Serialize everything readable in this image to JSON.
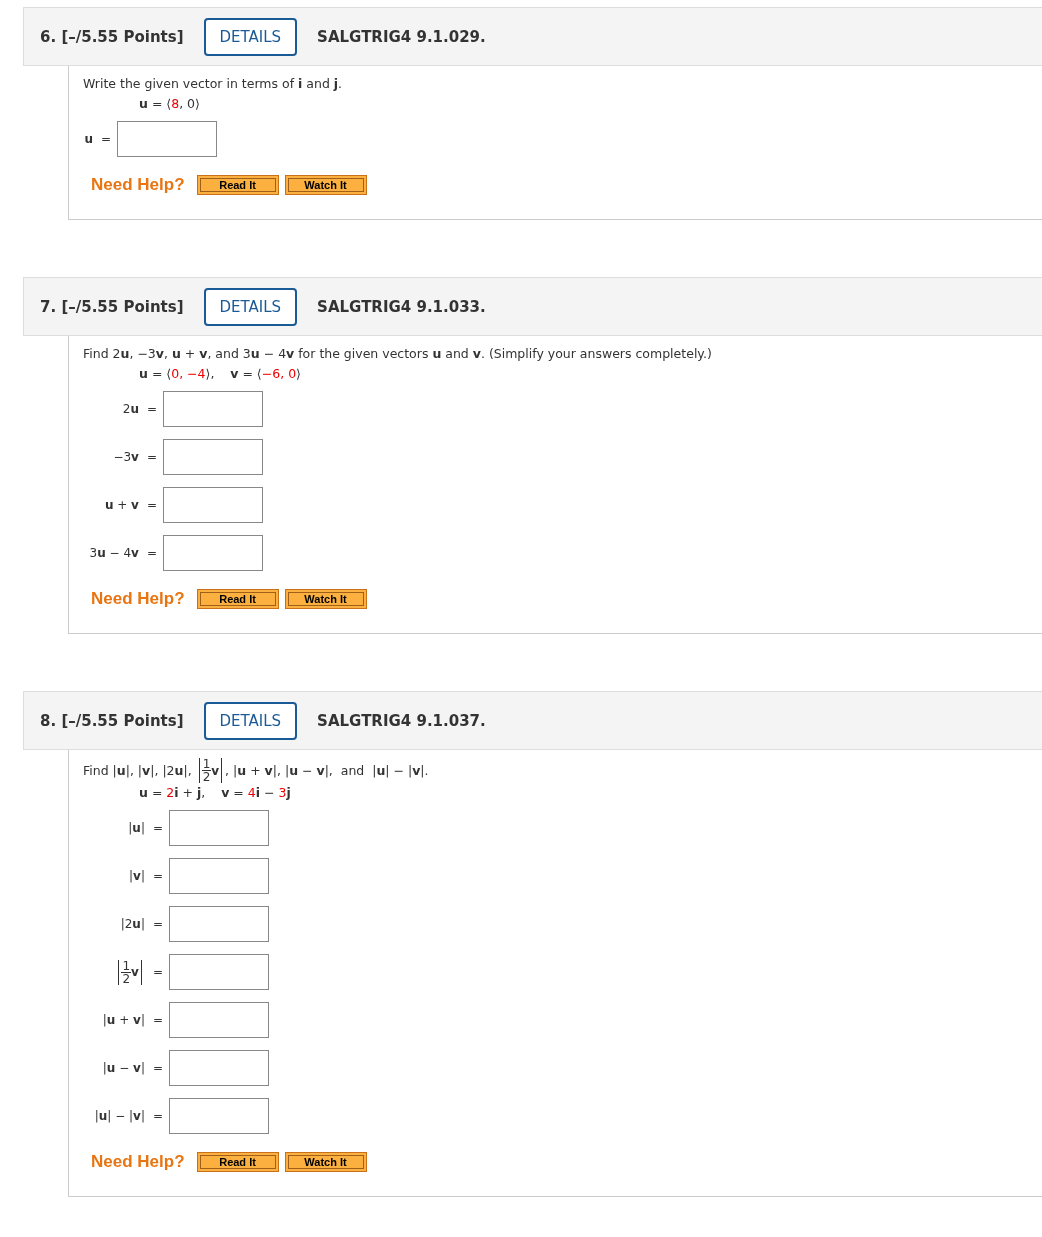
{
  "questions": [
    {
      "number": "6.",
      "points": "[–/5.55 Points]",
      "details": "DETAILS",
      "code": "SALGTRIG4 9.1.029.",
      "intro": [
        {
          "kind": "text",
          "text": "Write the given vector in terms of **i** and **j**."
        }
      ],
      "given": [
        {
          "kind": "plain",
          "text": "**u** = ⟨"
        },
        {
          "kind": "value",
          "text": "8"
        },
        {
          "kind": "plain",
          "text": ", 0⟩"
        }
      ],
      "answers": [
        {
          "kind": "text",
          "label": "**u**",
          "equals": "="
        }
      ],
      "help": {
        "label": "Need Help?",
        "buttons": [
          "Read It",
          "Watch It"
        ]
      }
    },
    {
      "number": "7.",
      "points": "[–/5.55 Points]",
      "details": "DETAILS",
      "code": "SALGTRIG4 9.1.033.",
      "intro": [
        {
          "kind": "text",
          "text": "Find 2**u**, −3**v**, **u** + **v**, and 3**u** − 4**v** for the given vectors **u** and **v**. (Simplify your answers completely.)"
        }
      ],
      "given": [
        {
          "kind": "plain",
          "text": "**u** = ⟨"
        },
        {
          "kind": "value",
          "text": "0, −4"
        },
        {
          "kind": "plain",
          "text": "⟩,    **v** = ⟨"
        },
        {
          "kind": "value",
          "text": "−6, 0"
        },
        {
          "kind": "plain",
          "text": "⟩"
        }
      ],
      "answers": [
        {
          "kind": "text",
          "label": "2**u**",
          "equals": "="
        },
        {
          "kind": "text",
          "label": "−3**v**",
          "equals": "="
        },
        {
          "kind": "text",
          "label": "**u** + **v**",
          "equals": "="
        },
        {
          "kind": "text",
          "label": "3**u** − 4**v**",
          "equals": "="
        }
      ],
      "help": {
        "label": "Need Help?",
        "buttons": [
          "Read It",
          "Watch It"
        ]
      }
    },
    {
      "number": "8.",
      "points": "[–/5.55 Points]",
      "details": "DETAILS",
      "code": "SALGTRIG4 9.1.037.",
      "intro": [
        {
          "kind": "text",
          "text": "Find |**u**|, |**v**|, |2**u**|, "
        },
        {
          "kind": "fraction",
          "numerator": "1",
          "denominator": "2",
          "variable": "**v**"
        },
        {
          "kind": "text",
          "text": ", |**u** + **v**|, |**u** − **v**|,  and  |**u**| − |**v**|."
        }
      ],
      "given": [
        {
          "kind": "plain",
          "text": "**u** = "
        },
        {
          "kind": "value",
          "text": "2"
        },
        {
          "kind": "plain",
          "text": "**i** + **j**,    **v** = "
        },
        {
          "kind": "value",
          "text": "4"
        },
        {
          "kind": "plain",
          "text": "**i** − "
        },
        {
          "kind": "value",
          "text": "3"
        },
        {
          "kind": "plain",
          "text": "**j**"
        }
      ],
      "answers": [
        {
          "kind": "text",
          "label": "|**u**|",
          "equals": "="
        },
        {
          "kind": "text",
          "label": "|**v**|",
          "equals": "="
        },
        {
          "kind": "text",
          "label": "|2**u**|",
          "equals": "="
        },
        {
          "kind": "fraction",
          "numerator": "1",
          "denominator": "2",
          "variable": "**v**",
          "equals": "="
        },
        {
          "kind": "text",
          "label": "|**u** + **v**|",
          "equals": "="
        },
        {
          "kind": "text",
          "label": "|**u** − **v**|",
          "equals": "="
        },
        {
          "kind": "text",
          "label": "|**u**| − |**v**|",
          "equals": "="
        }
      ],
      "help": {
        "label": "Need Help?",
        "buttons": [
          "Read It",
          "Watch It"
        ]
      }
    }
  ]
}
